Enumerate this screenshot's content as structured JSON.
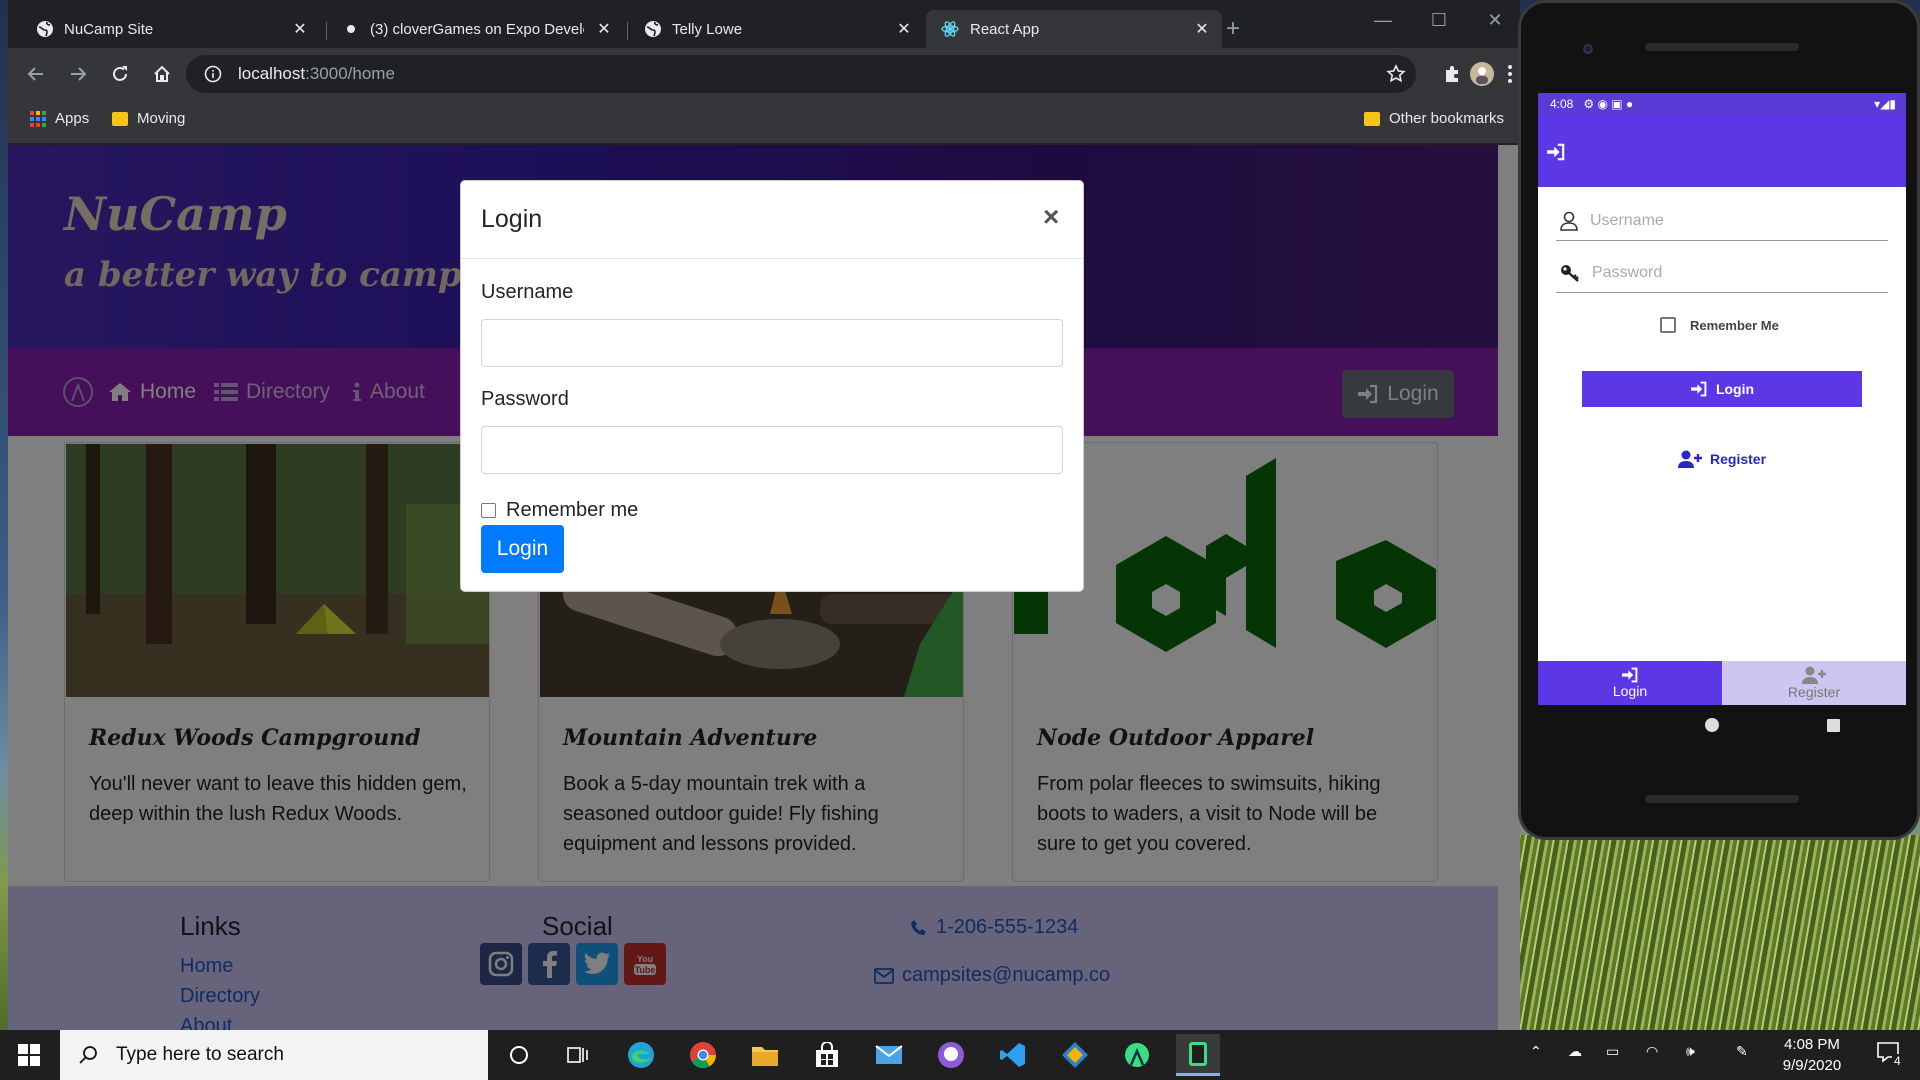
{
  "browser": {
    "tabs": [
      {
        "title": "NuCamp Site"
      },
      {
        "title": "(3) cloverGames on Expo Develo"
      },
      {
        "title": "Telly Lowe"
      },
      {
        "title": "React App"
      }
    ],
    "url_host": "localhost",
    "url_path": ":3000/home",
    "bookmarks": {
      "apps": "Apps",
      "moving": "Moving",
      "other": "Other bookmarks"
    }
  },
  "site": {
    "brand": "NuCamp",
    "tagline": "a better way to camp",
    "nav": {
      "home": "Home",
      "directory": "Directory",
      "about": "About",
      "login": "Login"
    },
    "cards": [
      {
        "title": "Redux Woods Campground",
        "text": "You'll never want to leave this hidden gem, deep within the lush Redux Woods."
      },
      {
        "title": "Mountain Adventure",
        "text": "Book a 5-day mountain trek with a seasoned outdoor guide! Fly fishing equipment and lessons provided."
      },
      {
        "title": "Node Outdoor Apparel",
        "text": "From polar fleeces to swimsuits, hiking boots to waders, a visit to Node will be sure to get you covered."
      }
    ],
    "footer": {
      "links_heading": "Links",
      "links": [
        "Home",
        "Directory",
        "About"
      ],
      "social_heading": "Social",
      "phone": "1-206-555-1234",
      "email": "campsites@nucamp.co"
    }
  },
  "modal": {
    "title": "Login",
    "close": "×",
    "username_label": "Username",
    "username_value": "",
    "password_label": "Password",
    "password_value": "",
    "remember": "Remember me",
    "submit": "Login"
  },
  "phone": {
    "time": "4:08",
    "username_placeholder": "Username",
    "password_placeholder": "Password",
    "remember": "Remember Me",
    "login_button": "Login",
    "register_button": "Register",
    "tab_login": "Login",
    "tab_register": "Register"
  },
  "taskbar": {
    "search_placeholder": "Type here to search",
    "time": "4:08 PM",
    "date": "9/9/2020",
    "notifications": "4"
  },
  "colors": {
    "jumbotron": "#4d2fbf",
    "navbar": "#8a1fb5",
    "modal_button": "#007bff",
    "phone_primary": "#5b37e6",
    "footer": "#cdc6f5"
  }
}
